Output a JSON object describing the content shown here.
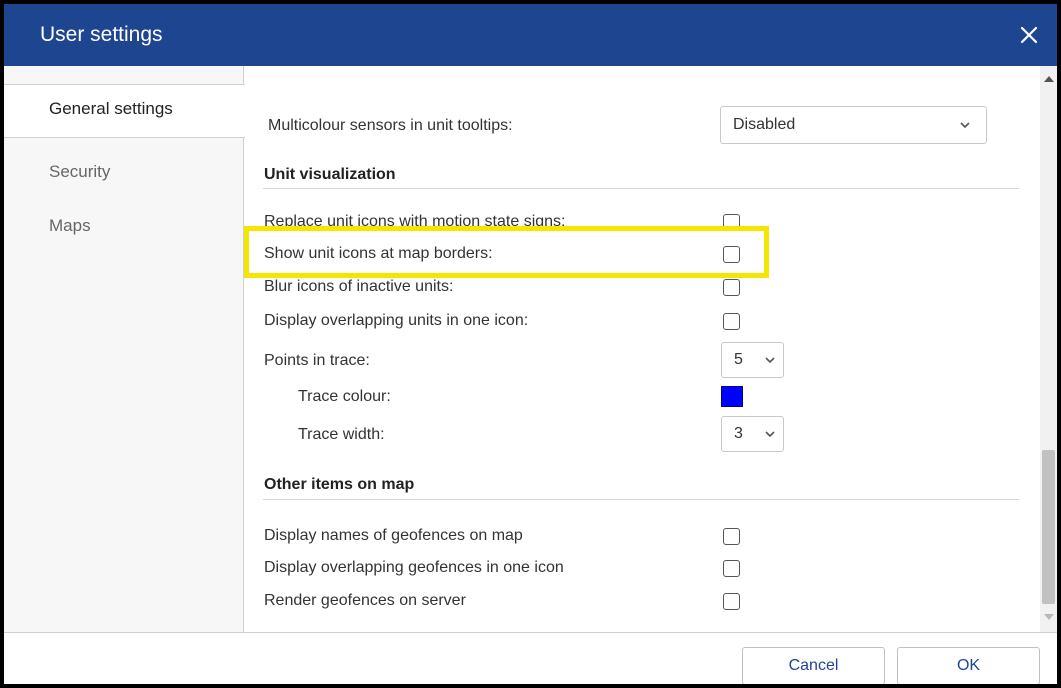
{
  "window": {
    "title": "User settings"
  },
  "sidebar": {
    "items": [
      {
        "label": "General settings",
        "active": true
      },
      {
        "label": "Security",
        "active": false
      },
      {
        "label": "Maps",
        "active": false
      }
    ]
  },
  "general": {
    "multicolour": {
      "label": "Multicolour sensors in unit tooltips:",
      "value": "Disabled"
    },
    "unit_visualization": {
      "heading": "Unit visualization",
      "replace_icons": {
        "label": "Replace unit icons with motion state signs:",
        "checked": false
      },
      "show_borders": {
        "label": "Show unit icons at map borders:",
        "checked": false
      },
      "blur_inactive": {
        "label": "Blur icons of inactive units:",
        "checked": false
      },
      "overlap_units": {
        "label": "Display overlapping units in one icon:",
        "checked": false
      },
      "points_in_trace": {
        "label": "Points in trace:",
        "value": "5"
      },
      "trace_colour": {
        "label": "Trace colour:",
        "color": "#0000ff"
      },
      "trace_width": {
        "label": "Trace width:",
        "value": "3"
      }
    },
    "other_items": {
      "heading": "Other items on map",
      "geofence_names": {
        "label": "Display names of geofences on map",
        "checked": false
      },
      "overlap_geofences": {
        "label": "Display overlapping geofences in one icon",
        "checked": false
      },
      "render_server": {
        "label": "Render geofences on server",
        "checked": false
      }
    }
  },
  "footer": {
    "cancel_label": "Cancel",
    "ok_label": "OK"
  },
  "colors": {
    "titlebar": "#1e4690",
    "highlight": "#f3e600",
    "accent_text": "#1e4690"
  },
  "icons": {
    "close": "close-icon",
    "chevron": "chevron-down-icon",
    "scroll_up": "arrow-up-icon",
    "scroll_down": "arrow-down-icon"
  }
}
